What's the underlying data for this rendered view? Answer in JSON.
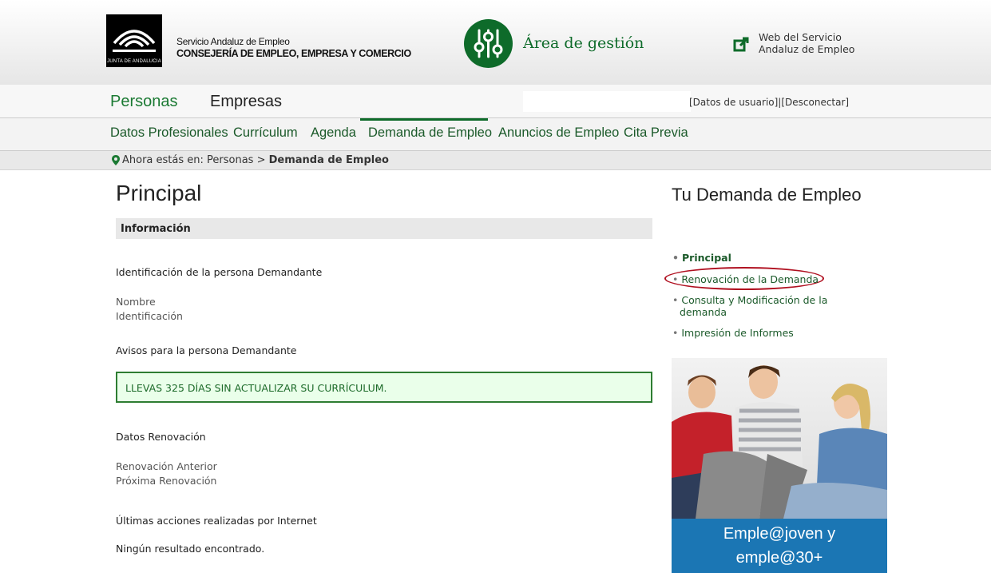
{
  "header": {
    "logo_text": "JUNTA DE ANDALUCIA",
    "org_line1": "Servicio Andaluz de Empleo",
    "org_line2": "CONSEJERÍA DE EMPLEO, EMPRESA Y COMERCIO",
    "area_title": "Área de gestión",
    "external_link_line1": "Web del Servicio",
    "external_link_line2": "Andaluz de Empleo"
  },
  "top_nav": {
    "personas": "Personas",
    "empresas": "Empresas",
    "user_links": "[Datos de usuario]|[Desconectar]"
  },
  "main_nav": {
    "items": [
      "Datos Profesionales",
      "Currículum",
      "Agenda",
      "Demanda de Empleo",
      "Anuncios de Empleo",
      "Cita Previa"
    ],
    "active": "Demanda de Empleo"
  },
  "breadcrumb": {
    "prefix": "Ahora estás en: Personas > ",
    "current": "Demanda de Empleo"
  },
  "main": {
    "title": "Principal",
    "section_bar": "Información",
    "identificacion_heading": "Identificación de la persona Demandante",
    "nombre_label": "Nombre",
    "identificacion_label": "Identificación",
    "avisos_heading": "Avisos para la persona Demandante",
    "alert_text": "LLEVAS 325 DÍAS SIN ACTUALIZAR SU CURRÍCULUM.",
    "renovacion_heading": "Datos Renovación",
    "renovacion_anterior_label": "Renovación Anterior",
    "proxima_renovacion_label": "Próxima Renovación",
    "ultimas_heading": "Últimas acciones realizadas por Internet",
    "no_results": "Ningún resultado encontrado."
  },
  "sidebar": {
    "title": "Tu Demanda de Empleo",
    "links": [
      "Principal",
      "Renovación de la Demanda",
      "Consulta y Modificación de la demanda",
      "Impresión de Informes"
    ],
    "promo_line1": "Emple@joven y",
    "promo_line2": "emple@30+"
  },
  "colors": {
    "brand_green": "#0e6b2a",
    "link_green": "#1b5a2a",
    "alert_bg": "#eaffea",
    "highlight_oval": "#b01020",
    "promo_blue": "#1b76b4"
  }
}
